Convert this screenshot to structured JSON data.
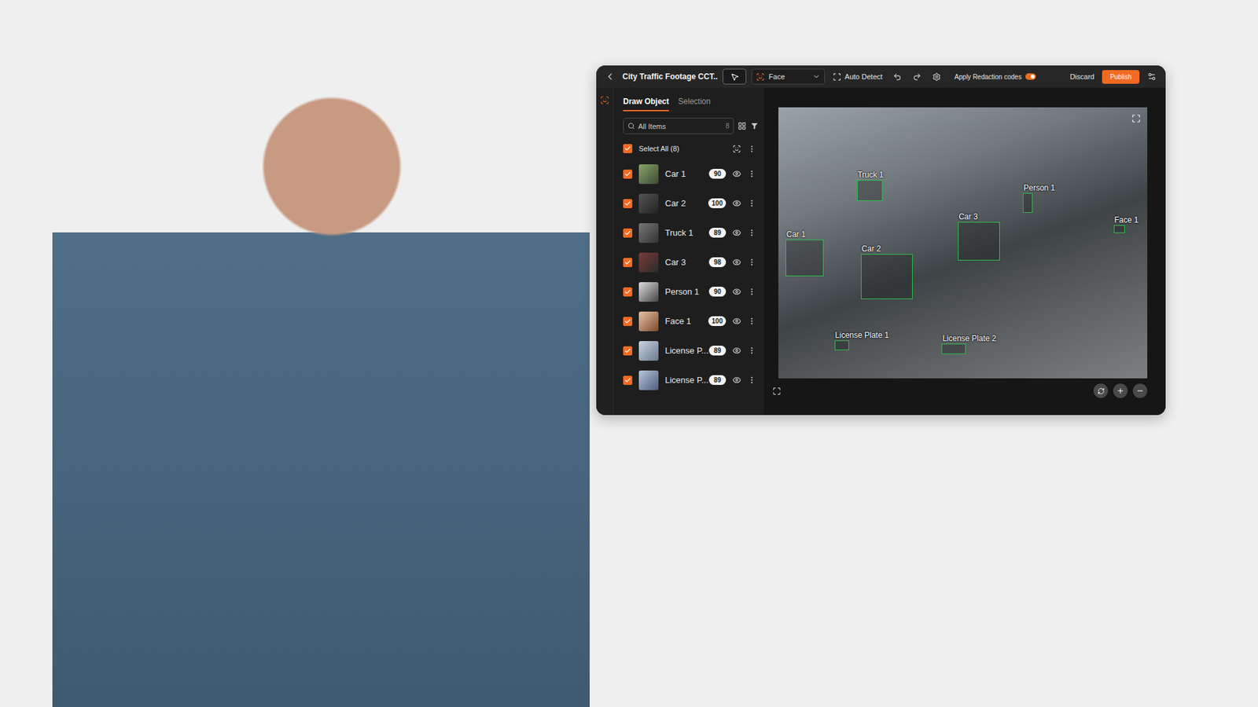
{
  "window": {
    "title": "City Traffic Footage CCT.."
  },
  "toolbar": {
    "pointer_selected": true,
    "mode": "Face",
    "auto_detect": "Auto Detect",
    "redaction": {
      "label": "Apply Redaction codes",
      "on": true
    },
    "discard": "Discard",
    "publish": "Publish"
  },
  "tabs": [
    {
      "label": "Draw Object",
      "selected": true
    },
    {
      "label": "Selection",
      "selected": false
    }
  ],
  "search": {
    "placeholder": "All Items",
    "count": "8"
  },
  "select_all": {
    "label": "Select All (8)",
    "checked": true
  },
  "items": [
    {
      "name": "Car 1",
      "score": "90",
      "checked": true,
      "visible": true
    },
    {
      "name": "Car 2",
      "score": "100",
      "checked": true,
      "visible": true
    },
    {
      "name": "Truck 1",
      "score": "89",
      "checked": true,
      "visible": true
    },
    {
      "name": "Car 3",
      "score": "98",
      "checked": true,
      "visible": true
    },
    {
      "name": "Person 1",
      "score": "90",
      "checked": true,
      "visible": true
    },
    {
      "name": "Face 1",
      "score": "100",
      "checked": true,
      "visible": true
    },
    {
      "name": "License P...",
      "score": "89",
      "checked": true,
      "visible": true
    },
    {
      "name": "License P...",
      "score": "89",
      "checked": true,
      "visible": true
    }
  ],
  "annotations": [
    {
      "label": "Truck 1"
    },
    {
      "label": "Person 1"
    },
    {
      "label": "Car 3"
    },
    {
      "label": "Face 1"
    },
    {
      "label": "Car 1"
    },
    {
      "label": "Car 2"
    },
    {
      "label": "License Plate 1"
    },
    {
      "label": "License Plate 2"
    }
  ]
}
